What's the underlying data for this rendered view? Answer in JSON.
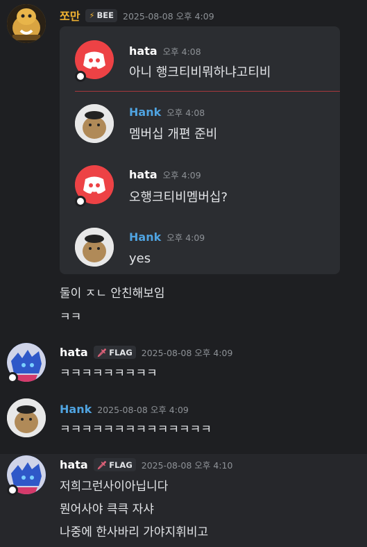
{
  "messages": {
    "m1": {
      "author": "쪼만",
      "tag_icon": "⚡",
      "tag": "BEE",
      "time": "2025-08-08 오후 4:09",
      "lines": [
        "둘이 ㅈㄴ 안친해보임",
        "ㅋㅋ"
      ]
    },
    "m2": {
      "author": "hata",
      "tag_icon": "🗡",
      "tag": "FLAG",
      "time": "2025-08-08 오후 4:09",
      "lines": [
        "ㅋㅋㅋㅋㅋㅋㅋㅋㅋ"
      ]
    },
    "m3": {
      "author": "Hank",
      "time": "2025-08-08 오후 4:09",
      "lines": [
        "ㅋㅋㅋㅋㅋㅋㅋㅋㅋㅋㅋㅋㅋㅋ"
      ]
    },
    "m4": {
      "author": "hata",
      "tag_icon": "🗡",
      "tag": "FLAG",
      "time": "2025-08-08 오후 4:10",
      "lines": [
        "저희그런사이아닙니다",
        "뭔어사야 큭큭 자샤",
        "나중에 한사바리 가야지휘비고"
      ]
    }
  },
  "embed": {
    "items": [
      {
        "author": "hata",
        "time": "오후 4:08",
        "text": "아니 행크티비뭐하냐고티비",
        "color": "#ffffff"
      },
      {
        "author": "Hank",
        "time": "오후 4:08",
        "text": "멤버십 개편 준비",
        "color": "#4fa3e0"
      },
      {
        "author": "hata",
        "time": "오후 4:09",
        "text": "오행크티비멤버십?",
        "color": "#ffffff"
      },
      {
        "author": "Hank",
        "time": "오후 4:09",
        "text": "yes",
        "color": "#4fa3e0"
      }
    ]
  },
  "colors": {
    "background": "#1e1f22",
    "embed": "#2b2d31",
    "divider": "#a8383d",
    "zzoman_name": "#f0b232",
    "hank_name": "#4fa3e0",
    "discord_red": "#ed4245"
  },
  "icons": [
    "discord-logo-icon",
    "bee-lightning-icon",
    "flag-sword-icon",
    "hank-avatar-icon",
    "hata-avatar-icon",
    "zzoman-avatar-icon"
  ]
}
